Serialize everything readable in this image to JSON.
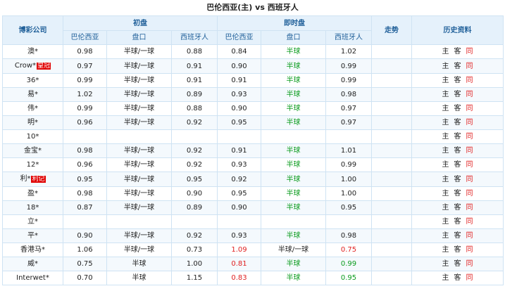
{
  "title": "巴伦西亚(主) vs 西班牙人",
  "header": {
    "company": "博彩公司",
    "initial": "初盘",
    "live": "即时盘",
    "trend": "走势",
    "history": "历史资料",
    "home": "巴伦西亚",
    "line": "盘口",
    "away": "西班牙人"
  },
  "history_links": {
    "home": "主",
    "away": "客",
    "same": "同"
  },
  "rows": [
    {
      "company": "澳*",
      "badge": "",
      "i_home": "0.98",
      "i_line": "半球/一球",
      "i_away": "0.88",
      "l_home": "0.84",
      "l_line": "半球",
      "l_away": "1.02"
    },
    {
      "company": "Crow*",
      "badge": "皇冠",
      "i_home": "0.97",
      "i_line": "半球/一球",
      "i_away": "0.91",
      "l_home": "0.90",
      "l_line": "半球",
      "l_away": "0.99"
    },
    {
      "company": "36*",
      "badge": "",
      "i_home": "0.99",
      "i_line": "半球/一球",
      "i_away": "0.91",
      "l_home": "0.91",
      "l_line": "半球",
      "l_away": "0.99"
    },
    {
      "company": "易*",
      "badge": "",
      "i_home": "1.02",
      "i_line": "半球/一球",
      "i_away": "0.89",
      "l_home": "0.93",
      "l_line": "半球",
      "l_away": "0.98"
    },
    {
      "company": "伟*",
      "badge": "",
      "i_home": "0.99",
      "i_line": "半球/一球",
      "i_away": "0.88",
      "l_home": "0.90",
      "l_line": "半球",
      "l_away": "0.97"
    },
    {
      "company": "明*",
      "badge": "",
      "i_home": "0.96",
      "i_line": "半球/一球",
      "i_away": "0.92",
      "l_home": "0.95",
      "l_line": "半球",
      "l_away": "0.97"
    },
    {
      "company": "10*",
      "badge": "",
      "i_home": "",
      "i_line": "",
      "i_away": "",
      "l_home": "",
      "l_line": "",
      "l_away": ""
    },
    {
      "company": "金宝*",
      "badge": "",
      "i_home": "0.98",
      "i_line": "半球/一球",
      "i_away": "0.92",
      "l_home": "0.91",
      "l_line": "半球",
      "l_away": "1.01"
    },
    {
      "company": "12*",
      "badge": "",
      "i_home": "0.96",
      "i_line": "半球/一球",
      "i_away": "0.92",
      "l_home": "0.93",
      "l_line": "半球",
      "l_away": "0.99"
    },
    {
      "company": "利*",
      "badge": "利记",
      "i_home": "0.95",
      "i_line": "半球/一球",
      "i_away": "0.95",
      "l_home": "0.92",
      "l_line": "半球",
      "l_away": "1.00"
    },
    {
      "company": "盈*",
      "badge": "",
      "i_home": "0.98",
      "i_line": "半球/一球",
      "i_away": "0.90",
      "l_home": "0.95",
      "l_line": "半球",
      "l_away": "1.00"
    },
    {
      "company": "18*",
      "badge": "",
      "i_home": "0.87",
      "i_line": "半球/一球",
      "i_away": "0.89",
      "l_home": "0.90",
      "l_line": "半球",
      "l_away": "0.95"
    },
    {
      "company": "立*",
      "badge": "",
      "i_home": "",
      "i_line": "",
      "i_away": "",
      "l_home": "",
      "l_line": "",
      "l_away": ""
    },
    {
      "company": "平*",
      "badge": "",
      "i_home": "0.90",
      "i_line": "半球/一球",
      "i_away": "0.92",
      "l_home": "0.93",
      "l_line": "半球",
      "l_away": "0.98"
    },
    {
      "company": "香港马*",
      "badge": "",
      "i_home": "1.06",
      "i_line": "半球/一球",
      "i_away": "0.73",
      "l_home": "1.09",
      "l_line": "半球/一球",
      "l_away": "0.75",
      "c_home": "red",
      "c_line": "plain",
      "c_away": "red"
    },
    {
      "company": "威*",
      "badge": "",
      "i_home": "0.75",
      "i_line": "半球",
      "i_away": "1.00",
      "l_home": "0.81",
      "l_line": "半球",
      "l_away": "0.99",
      "c_home": "red",
      "c_away": "green"
    },
    {
      "company": "Interwet*",
      "badge": "",
      "i_home": "0.70",
      "i_line": "半球",
      "i_away": "1.15",
      "l_home": "0.83",
      "l_line": "半球",
      "l_away": "0.95",
      "c_home": "red",
      "c_away": "green"
    }
  ]
}
